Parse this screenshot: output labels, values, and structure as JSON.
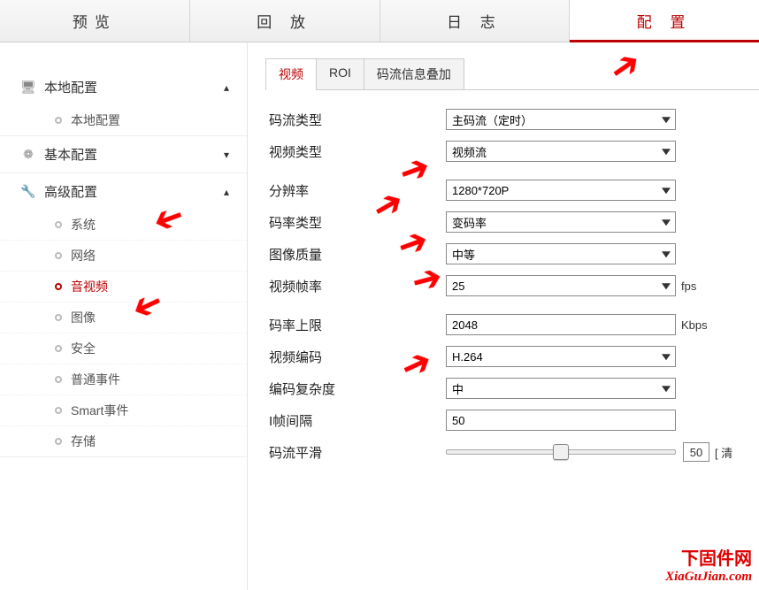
{
  "top_tabs": {
    "preview": "预览",
    "playback": "回 放",
    "log": "日 志",
    "config": "配 置"
  },
  "sidebar": {
    "groups": [
      {
        "icon": "🖥",
        "label": "本地配置",
        "expanded": true,
        "items": [
          {
            "label": "本地配置",
            "active": false
          }
        ]
      },
      {
        "icon": "❁",
        "label": "基本配置",
        "expanded": false,
        "items": []
      },
      {
        "icon": "🔧",
        "label": "高级配置",
        "expanded": true,
        "items": [
          {
            "label": "系统",
            "active": false
          },
          {
            "label": "网络",
            "active": false
          },
          {
            "label": "音视频",
            "active": true
          },
          {
            "label": "图像",
            "active": false
          },
          {
            "label": "安全",
            "active": false
          },
          {
            "label": "普通事件",
            "active": false
          },
          {
            "label": "Smart事件",
            "active": false
          },
          {
            "label": "存储",
            "active": false
          }
        ]
      }
    ]
  },
  "sub_tabs": {
    "video": "视频",
    "roi": "ROI",
    "overlay": "码流信息叠加"
  },
  "form": {
    "stream_type": {
      "label": "码流类型",
      "value": "主码流（定时）"
    },
    "video_type": {
      "label": "视频类型",
      "value": "视频流"
    },
    "resolution": {
      "label": "分辨率",
      "value": "1280*720P"
    },
    "bitrate_type": {
      "label": "码率类型",
      "value": "变码率"
    },
    "image_quality": {
      "label": "图像质量",
      "value": "中等"
    },
    "frame_rate": {
      "label": "视频帧率",
      "value": "25",
      "unit": "fps"
    },
    "max_bitrate": {
      "label": "码率上限",
      "value": "2048",
      "unit": "Kbps"
    },
    "video_encoding": {
      "label": "视频编码",
      "value": "H.264"
    },
    "profile": {
      "label": "编码复杂度",
      "value": "中"
    },
    "iframe_interval": {
      "label": "I帧间隔",
      "value": "50"
    },
    "smoothing": {
      "label": "码流平滑",
      "value": "50",
      "suffix": "[ 清"
    }
  },
  "watermark": {
    "line1": "下固件网",
    "line2": "XiaGuJian.com"
  }
}
